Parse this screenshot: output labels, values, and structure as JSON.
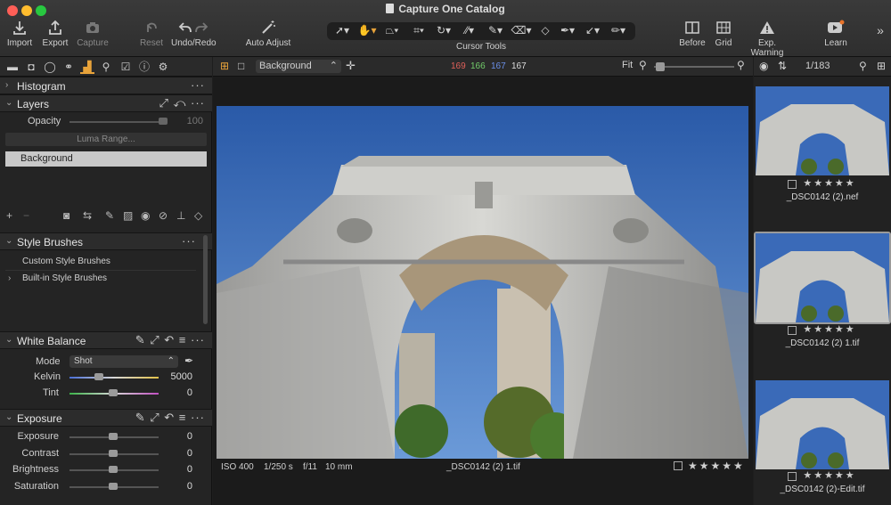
{
  "window": {
    "title": "Capture One Catalog"
  },
  "toolbar": {
    "import": "Import",
    "export": "Export",
    "capture": "Capture",
    "reset": "Reset",
    "undo_redo": "Undo/Redo",
    "auto_adjust": "Auto Adjust",
    "cursor_tools": "Cursor Tools",
    "before": "Before",
    "grid": "Grid",
    "exp_warning": "Exp. Warning",
    "learn": "Learn"
  },
  "viewer_bar": {
    "layer_select": "Background",
    "color_r": "169",
    "color_g": "166",
    "color_b": "167",
    "color_l": "167",
    "zoom": "Fit"
  },
  "browser_bar": {
    "counter": "1/183"
  },
  "panels": {
    "histogram": {
      "title": "Histogram"
    },
    "layers": {
      "title": "Layers",
      "opacity_label": "Opacity",
      "opacity_value": "100",
      "luma_button": "Luma Range...",
      "layer_item": "Background"
    },
    "style_brushes": {
      "title": "Style Brushes",
      "items": [
        "Custom Style Brushes",
        "Built-in Style Brushes"
      ]
    },
    "white_balance": {
      "title": "White Balance",
      "mode_label": "Mode",
      "mode_value": "Shot",
      "kelvin_label": "Kelvin",
      "kelvin_value": "5000",
      "tint_label": "Tint",
      "tint_value": "0"
    },
    "exposure": {
      "title": "Exposure",
      "rows": [
        {
          "label": "Exposure",
          "value": "0"
        },
        {
          "label": "Contrast",
          "value": "0"
        },
        {
          "label": "Brightness",
          "value": "0"
        },
        {
          "label": "Saturation",
          "value": "0"
        }
      ]
    }
  },
  "photo_info": {
    "iso": "ISO 400",
    "shutter": "1/250 s",
    "aperture": "f/11",
    "focal": "10 mm",
    "filename": "_DSC0142 (2) 1.tif",
    "rating": 0
  },
  "thumbnails": [
    {
      "name": "_DSC0142 (2).nef",
      "rating": 0
    },
    {
      "name": "_DSC0142 (2) 1.tif",
      "rating": 0
    },
    {
      "name": "_DSC0142 (2)-Edit.tif",
      "rating": 0
    }
  ],
  "colors": {
    "accent": "#e8a33a",
    "selected_layer": "#c8c8c8"
  }
}
